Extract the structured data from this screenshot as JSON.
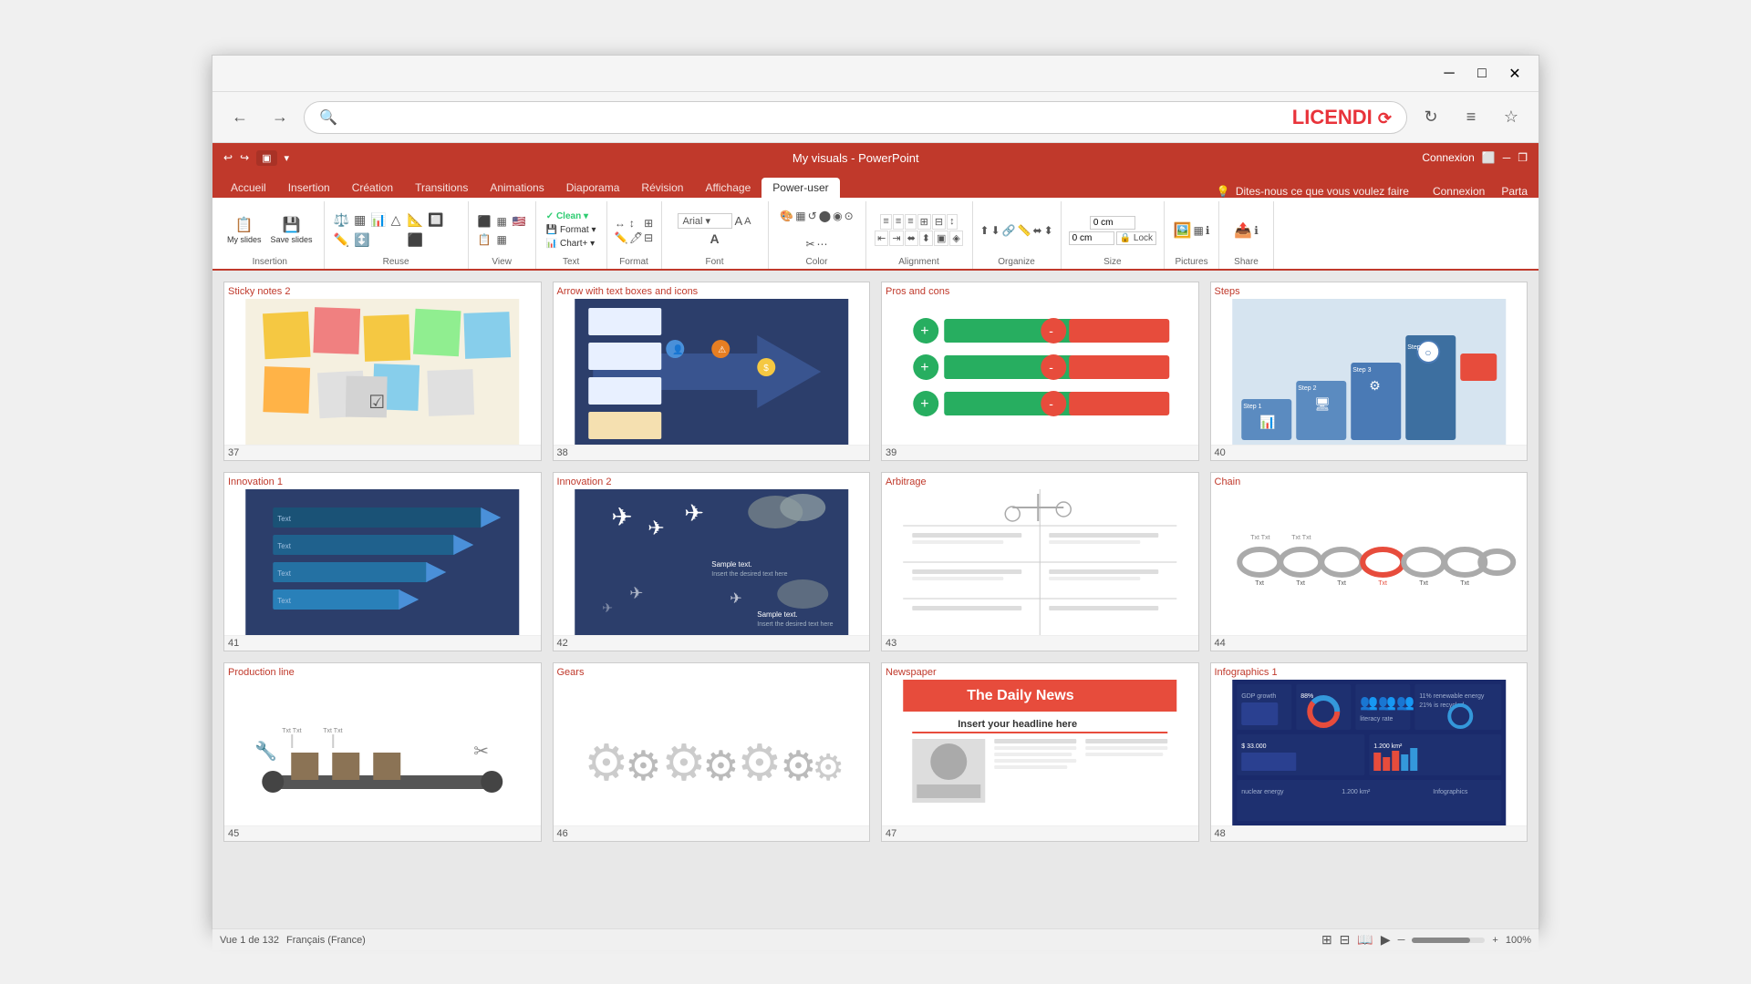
{
  "browser": {
    "titlebar": {
      "minimize": "─",
      "maximize": "□",
      "close": "✕"
    },
    "back_label": "←",
    "forward_label": "→",
    "search_placeholder": "",
    "logo": "LICENDI",
    "logo_arrow": "↺",
    "refresh_btn": "↻",
    "menu_btn": "≡",
    "favorites_btn": "☆"
  },
  "powerpoint": {
    "title": "My visuals - PowerPoint",
    "connexion": "Connexion",
    "partage": "Parta",
    "win_min": "─",
    "win_max": "□",
    "win_restore": "❐",
    "tabs": [
      {
        "label": "Accueil"
      },
      {
        "label": "Insertion"
      },
      {
        "label": "Création"
      },
      {
        "label": "Transitions"
      },
      {
        "label": "Animations"
      },
      {
        "label": "Diaporama"
      },
      {
        "label": "Révision"
      },
      {
        "label": "Affichage"
      },
      {
        "label": "Power-user",
        "active": true
      }
    ],
    "ribbon_hint": "Dites-nous ce que vous voulez faire",
    "ribbon_groups": [
      {
        "label": "Insertion",
        "buttons": [
          "My slides",
          "Save slides"
        ]
      },
      {
        "label": "Reuse",
        "buttons": []
      },
      {
        "label": "View",
        "buttons": []
      },
      {
        "label": "Text",
        "buttons": [
          "✓ Clean",
          "Format",
          "Chart+"
        ]
      },
      {
        "label": "Format",
        "buttons": []
      },
      {
        "label": "Font",
        "buttons": []
      },
      {
        "label": "Color",
        "buttons": []
      },
      {
        "label": "Alignment",
        "buttons": []
      },
      {
        "label": "Organize",
        "buttons": []
      },
      {
        "label": "Size",
        "buttons": [
          "0 cm",
          "0 cm",
          "Lock"
        ]
      },
      {
        "label": "Pictures",
        "buttons": []
      },
      {
        "label": "Share",
        "buttons": []
      }
    ]
  },
  "slides": [
    {
      "number": "37",
      "title": "Sticky notes 2",
      "type": "sticky"
    },
    {
      "number": "38",
      "title": "Arrow with text boxes and icons",
      "type": "arrow"
    },
    {
      "number": "39",
      "title": "Pros and cons",
      "type": "pros_cons"
    },
    {
      "number": "40",
      "title": "Steps",
      "type": "steps"
    },
    {
      "number": "41",
      "title": "Innovation 1",
      "type": "innovation1"
    },
    {
      "number": "42",
      "title": "Innovation 2",
      "type": "innovation2"
    },
    {
      "number": "43",
      "title": "Arbitrage",
      "type": "arbitrage"
    },
    {
      "number": "44",
      "title": "Chain",
      "type": "chain"
    },
    {
      "number": "45",
      "title": "Production line",
      "type": "production"
    },
    {
      "number": "46",
      "title": "Gears",
      "type": "gears"
    },
    {
      "number": "47",
      "title": "Newspaper",
      "type": "newspaper"
    },
    {
      "number": "48",
      "title": "Infographics 1",
      "type": "infographics"
    }
  ],
  "statusbar": {
    "slide_info": "Vue 1 de 132",
    "language": "Français (France)"
  }
}
